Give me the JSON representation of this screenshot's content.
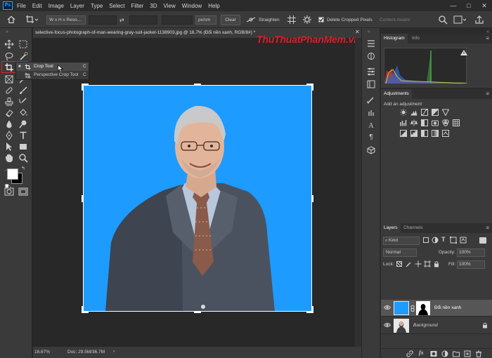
{
  "menu": [
    "File",
    "Edit",
    "Image",
    "Layer",
    "Type",
    "Select",
    "Filter",
    "3D",
    "View",
    "Window",
    "Help"
  ],
  "window_controls": {
    "minimize": "—",
    "maximize": "□",
    "close": "✕"
  },
  "options_bar": {
    "ratio": "W x H x Reso...",
    "unit": "px/cm",
    "clear": "Clear",
    "straighten": "Straighten",
    "delete_cropped": "Delete Cropped Pixels",
    "delete_cropped_checked": true,
    "content_aware": "Content-Aware"
  },
  "document": {
    "tab_title": "selective-focus-photograph-of-man-wearing-gray-suit-jacket-1138903.jpg @ 16.7% (Đổi nền xanh, RGB/8#) *",
    "watermark": "ThuThuatPhanMem.vn",
    "zoom": "16.67%",
    "doc_size": "Doc: 29.5M/36.7M",
    "background_color": "#1e9bff"
  },
  "flyout": {
    "items": [
      {
        "label": "Crop Tool",
        "shortcut": "C"
      },
      {
        "label": "Perspective Crop Tool",
        "shortcut": "C"
      }
    ]
  },
  "histogram_panel": {
    "tabs": [
      "Histogram",
      "Info"
    ]
  },
  "adjustments_panel": {
    "title": "Adjustments",
    "subtitle": "Add an adjustment"
  },
  "layers_panel": {
    "tabs": [
      "Layers",
      "Channels"
    ],
    "kind": "Kind",
    "blend_mode": "Normal",
    "opacity_label": "Opacity:",
    "opacity": "100%",
    "lock_label": "Lock:",
    "fill_label": "Fill:",
    "fill": "100%",
    "layers": [
      {
        "name": "Đổi nền xanh",
        "active": true
      },
      {
        "name": "Background",
        "active": false
      }
    ],
    "footer_fx": "fx"
  },
  "colors": {
    "accent": "#31a8ff",
    "highlight_red": "#e0242a",
    "canvas_blue": "#1e9bff"
  }
}
